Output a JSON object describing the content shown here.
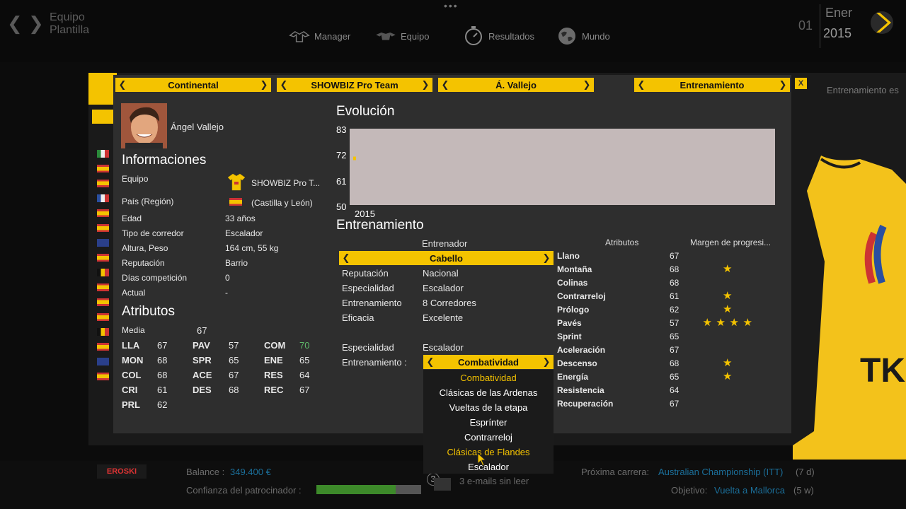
{
  "topbar": {
    "crumb1": "Equipo",
    "crumb2": "Plantilla",
    "menu": [
      "Manager",
      "Equipo",
      "Resultados",
      "Mundo"
    ],
    "day": "01",
    "month": "Ener",
    "year": "2015"
  },
  "background": {
    "right_text": "Entrenamiento es"
  },
  "selectors": {
    "s1": "Continental",
    "s2": "SHOWBIZ Pro Team",
    "s3": "Á. Vallejo",
    "s4": "Entrenamiento",
    "close": "X"
  },
  "rider": {
    "name": "Ángel Vallejo"
  },
  "info": {
    "title": "Informaciones",
    "rows": [
      {
        "label": "Equipo",
        "value": "SHOWBIZ Pro T..."
      },
      {
        "label": "País (Región)",
        "value": "(Castilla y León)"
      },
      {
        "label": "Edad",
        "value": "33 años"
      },
      {
        "label": "Tipo de corredor",
        "value": "Escalador"
      },
      {
        "label": "Altura, Peso",
        "value": "164 cm, 55 kg"
      },
      {
        "label": "Reputación",
        "value": "Barrio"
      },
      {
        "label": "Días competición",
        "value": "0"
      },
      {
        "label": "Actual",
        "value": "-"
      }
    ]
  },
  "attributes": {
    "title": "Atributos",
    "media_label": "Media",
    "media_value": "67",
    "grid": [
      [
        {
          "k": "LLA",
          "v": "67"
        },
        {
          "k": "PAV",
          "v": "57"
        },
        {
          "k": "COM",
          "v": "70"
        }
      ],
      [
        {
          "k": "MON",
          "v": "68"
        },
        {
          "k": "SPR",
          "v": "65"
        },
        {
          "k": "ENE",
          "v": "65"
        }
      ],
      [
        {
          "k": "COL",
          "v": "68"
        },
        {
          "k": "ACE",
          "v": "67"
        },
        {
          "k": "RES",
          "v": "64"
        }
      ],
      [
        {
          "k": "CRI",
          "v": "61"
        },
        {
          "k": "DES",
          "v": "68"
        },
        {
          "k": "REC",
          "v": "67"
        }
      ],
      [
        {
          "k": "PRL",
          "v": "62"
        }
      ]
    ]
  },
  "evolucion": {
    "title": "Evolución",
    "ticks": [
      "83",
      "72",
      "61",
      "50"
    ],
    "xlabel": "2015"
  },
  "chart_data": {
    "type": "line",
    "title": "Evolución",
    "x": [
      "2015"
    ],
    "values": [
      70
    ],
    "ylim": [
      50,
      83
    ],
    "yticks": [
      83,
      72,
      61,
      50
    ],
    "grid": false
  },
  "training": {
    "title": "Entrenamiento",
    "coach_header": "Entrenador",
    "coach_selected": "Cabello",
    "rows": [
      {
        "label": "Reputación",
        "value": "Nacional"
      },
      {
        "label": "Especialidad",
        "value": "Escalador"
      },
      {
        "label": "Entrenamiento",
        "value": "8 Corredores"
      },
      {
        "label": "Eficacia",
        "value": "Excelente"
      }
    ],
    "spec_label": "Especialidad",
    "spec_value": "Escalador",
    "train_label": "Entrenamiento :",
    "train_selected": "Combatividad",
    "options": [
      "Combatividad",
      "Clásicas de las Ardenas",
      "Vueltas de la etapa",
      "Esprínter",
      "Contrarreloj",
      "Clásicas de Flandes",
      "Escalador"
    ]
  },
  "progress": {
    "header_attr": "Atributos",
    "header_margin": "Margen de progresi...",
    "rows": [
      {
        "name": "Llano",
        "value": "67",
        "stars": 0
      },
      {
        "name": "Montaña",
        "value": "68",
        "stars": 1
      },
      {
        "name": "Colinas",
        "value": "68",
        "stars": 0
      },
      {
        "name": "Contrarreloj",
        "value": "61",
        "stars": 1
      },
      {
        "name": "Prólogo",
        "value": "62",
        "stars": 1
      },
      {
        "name": "Pavés",
        "value": "57",
        "stars": 4
      },
      {
        "name": "Sprint",
        "value": "65",
        "stars": 0
      },
      {
        "name": "Aceleración",
        "value": "67",
        "stars": 0
      },
      {
        "name": "Descenso",
        "value": "68",
        "stars": 1
      },
      {
        "name": "Energía",
        "value": "65",
        "stars": 1
      },
      {
        "name": "Resistencia",
        "value": "64",
        "stars": 0
      },
      {
        "name": "Recuperación",
        "value": "67",
        "stars": 0
      }
    ]
  },
  "bottom": {
    "sponsor": "EROSKI",
    "balance_label": "Balance :",
    "balance_value": "349.400 €",
    "conf_label": "Confianza del patrocinador :",
    "conf_level": 0.76,
    "mail_count": "3",
    "mail_text": "3 e-mails sin leer",
    "next_label": "Próxima carrera:",
    "next_value": "Australian Championship (ITT)",
    "next_days": "(7 d)",
    "obj_label": "Objetivo:",
    "obj_value": "Vuelta a Mallorca",
    "obj_weeks": "(5 w)"
  },
  "colors": {
    "accent": "#f4c300",
    "panel": "#2e2e2e",
    "link": "#1b6f9a",
    "green": "#5eb86a"
  }
}
